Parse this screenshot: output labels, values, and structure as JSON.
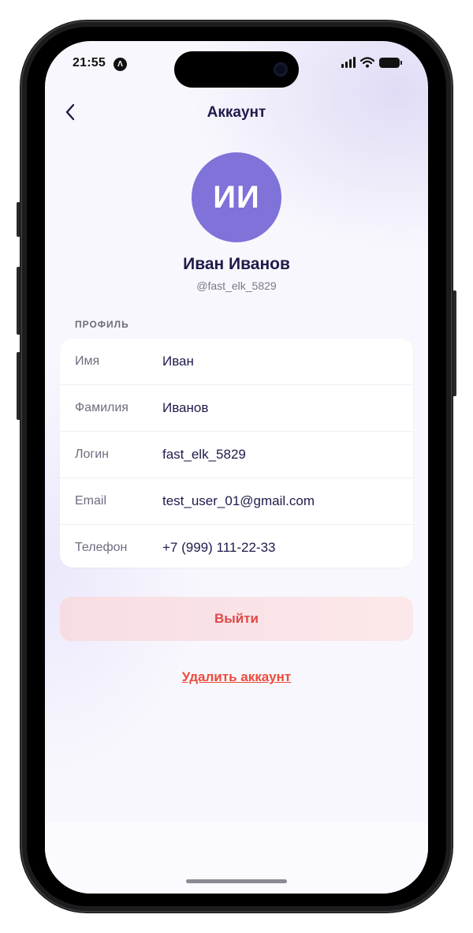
{
  "status_bar": {
    "time": "21:55",
    "badge_glyph": "Λ",
    "icons": [
      "cellular-signal-icon",
      "wifi-icon",
      "battery-icon"
    ]
  },
  "nav": {
    "back_icon": "chevron-left-icon",
    "title": "Аккаунт"
  },
  "profile_header": {
    "initials": "ИИ",
    "full_name": "Иван Иванов",
    "handle": "@fast_elk_5829",
    "avatar_color": "#7f72d8"
  },
  "profile_section": {
    "label": "ПРОФИЛЬ",
    "rows": [
      {
        "label": "Имя",
        "value": "Иван"
      },
      {
        "label": "Фамилия",
        "value": "Иванов"
      },
      {
        "label": "Логин",
        "value": "fast_elk_5829"
      },
      {
        "label": "Email",
        "value": "test_user_01@gmail.com"
      },
      {
        "label": "Телефон",
        "value": "+7 (999) 111-22-33"
      }
    ]
  },
  "actions": {
    "logout_label": "Выйти",
    "delete_label": "Удалить аккаунт",
    "danger_color": "#e04848"
  },
  "colors": {
    "title_text": "#1e1b4b",
    "accent": "#7f72d8"
  }
}
